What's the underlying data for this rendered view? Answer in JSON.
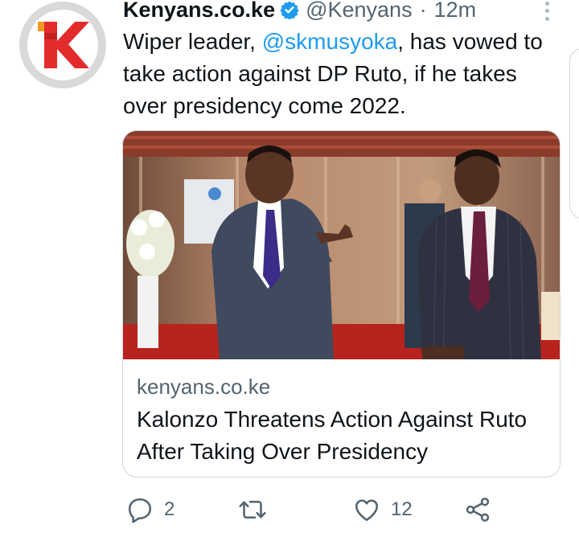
{
  "tweet": {
    "author_name": "Kenyans.co.ke",
    "handle": "@Kenyans",
    "separator": "·",
    "time": "12m",
    "text_parts": {
      "before": "Wiper leader, ",
      "mention": "@skmusyoka",
      "after": ", has vowed to take action against DP Ruto, if he takes over presidency come 2022."
    }
  },
  "card": {
    "domain": "kenyans.co.ke",
    "title": "Kalonzo Threatens Action Against Ruto After Taking Over Presidency"
  },
  "actions": {
    "reply_count": "2",
    "retweet_count": "",
    "like_count": "12"
  },
  "icons": {
    "avatar": "kenyans-logo-icon",
    "verified": "verified-badge-icon",
    "more": "more-dots-icon",
    "reply": "reply-icon",
    "retweet": "retweet-icon",
    "like": "heart-icon",
    "share": "share-icon"
  },
  "colors": {
    "link": "#1d9bf0",
    "secondary_text": "#536471",
    "logo_red": "#e32b2b",
    "logo_orange": "#f29a1f",
    "card_border": "#cfd9de"
  }
}
